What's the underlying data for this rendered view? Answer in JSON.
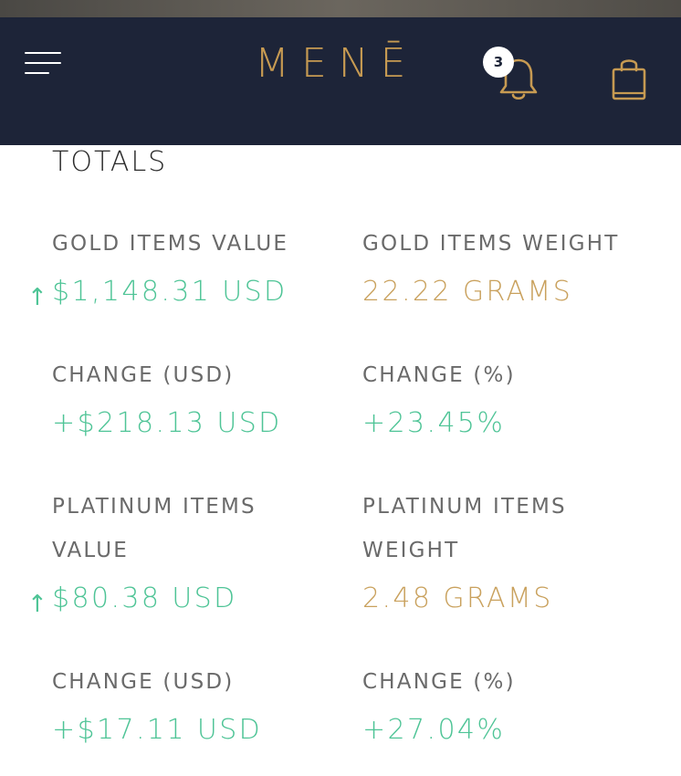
{
  "header": {
    "brand": "MENĒ",
    "notification_count": "3",
    "menu_icon": "hamburger-menu-icon",
    "bell_icon": "bell-icon",
    "bag_icon": "shopping-bag-icon"
  },
  "colors": {
    "header_bg": "#1d2438",
    "brand_gold": "#c69a52",
    "positive_green": "#4ec496",
    "weight_gold": "#c9a15d",
    "label_gray": "#6a6a6a"
  },
  "totals": {
    "title": "TOTALS",
    "gold": {
      "value_label": "GOLD ITEMS VALUE",
      "value": "$1,148.31 USD",
      "trend_arrow": "↑",
      "weight_label": "GOLD ITEMS WEIGHT",
      "weight": "22.22 GRAMS",
      "change_usd_label": "CHANGE (USD)",
      "change_usd": "+$218.13 USD",
      "change_pct_label": "CHANGE (%)",
      "change_pct": "+23.45%"
    },
    "platinum": {
      "value_label_line1": "PLATINUM ITEMS",
      "value_label_line2": "VALUE",
      "value": "$80.38 USD",
      "trend_arrow": "↑",
      "weight_label_line1": "PLATINUM ITEMS",
      "weight_label_line2": "WEIGHT",
      "weight": "2.48 GRAMS",
      "change_usd_label": "CHANGE (USD)",
      "change_usd": "+$17.11 USD",
      "change_pct_label": "CHANGE (%)",
      "change_pct": "+27.04%"
    }
  }
}
